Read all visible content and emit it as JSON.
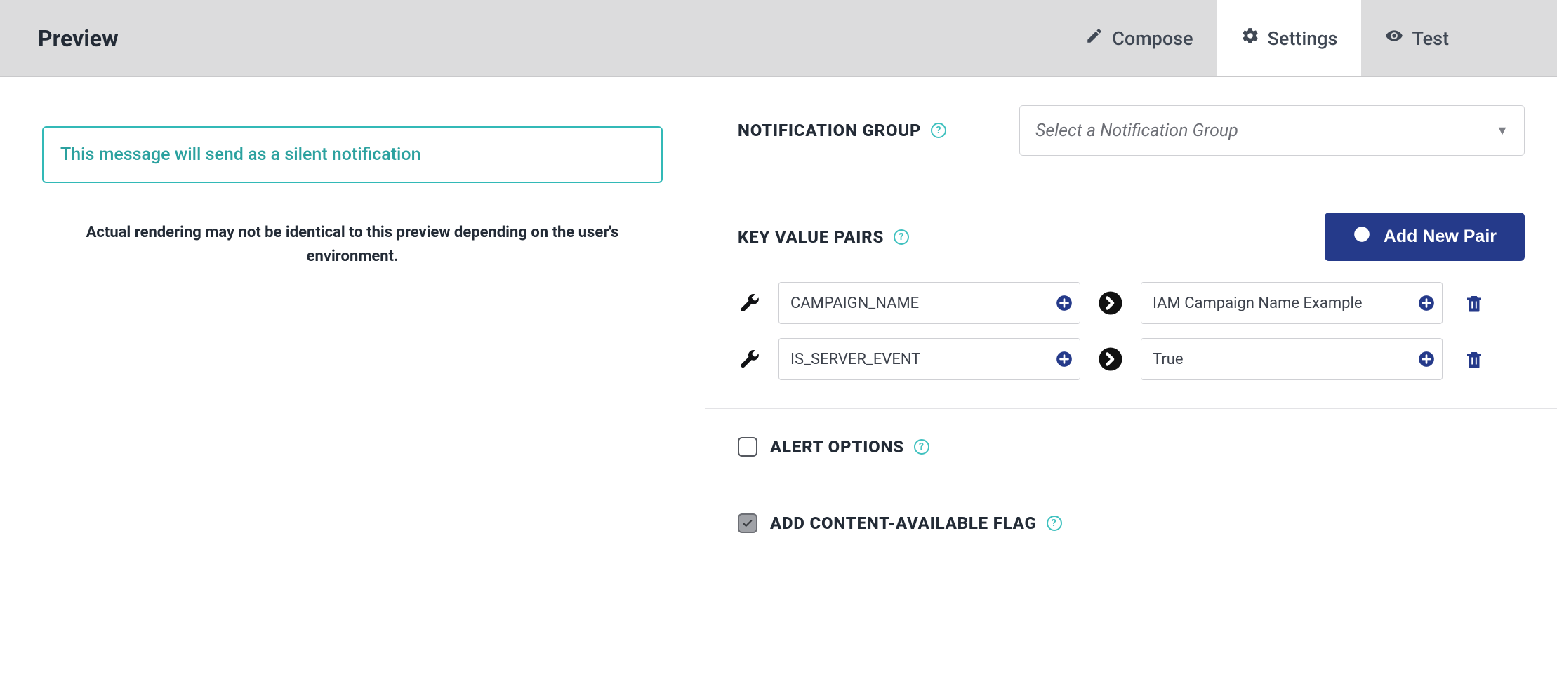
{
  "header": {
    "title": "Preview",
    "tabs": [
      {
        "label": "Compose",
        "icon": "pencil"
      },
      {
        "label": "Settings",
        "icon": "gear"
      },
      {
        "label": "Test",
        "icon": "eye"
      }
    ],
    "active_tab_index": 1
  },
  "preview": {
    "notice": "This message will send as a silent notification",
    "disclaimer": "Actual rendering may not be identical to this preview depending on the user's environment."
  },
  "settings": {
    "notification_group": {
      "label": "NOTIFICATION GROUP",
      "placeholder": "Select a Notification Group",
      "selected": ""
    },
    "key_value_pairs": {
      "label": "KEY VALUE PAIRS",
      "add_button_label": "Add New Pair",
      "pairs": [
        {
          "key": "CAMPAIGN_NAME",
          "value": "IAM Campaign Name Example"
        },
        {
          "key": "IS_SERVER_EVENT",
          "value": "True"
        }
      ]
    },
    "alert_options": {
      "label": "ALERT OPTIONS",
      "checked": false
    },
    "content_available_flag": {
      "label": "ADD CONTENT-AVAILABLE FLAG",
      "checked": true
    }
  }
}
